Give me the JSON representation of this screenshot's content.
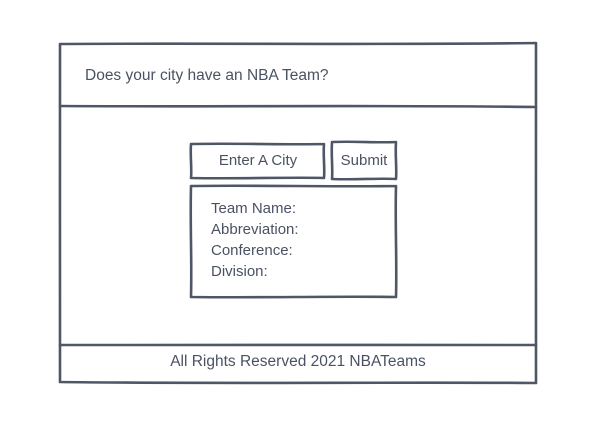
{
  "header": {
    "question": "Does your city have an NBA Team?"
  },
  "search": {
    "placeholder": "Enter A City",
    "value": ""
  },
  "submit": {
    "label": "Submit"
  },
  "result": {
    "team_name_label": "Team Name:",
    "abbreviation_label": "Abbreviation:",
    "conference_label": "Conference:",
    "division_label": "Division:"
  },
  "footer": {
    "text": "All Rights Reserved 2021 NBATeams"
  }
}
